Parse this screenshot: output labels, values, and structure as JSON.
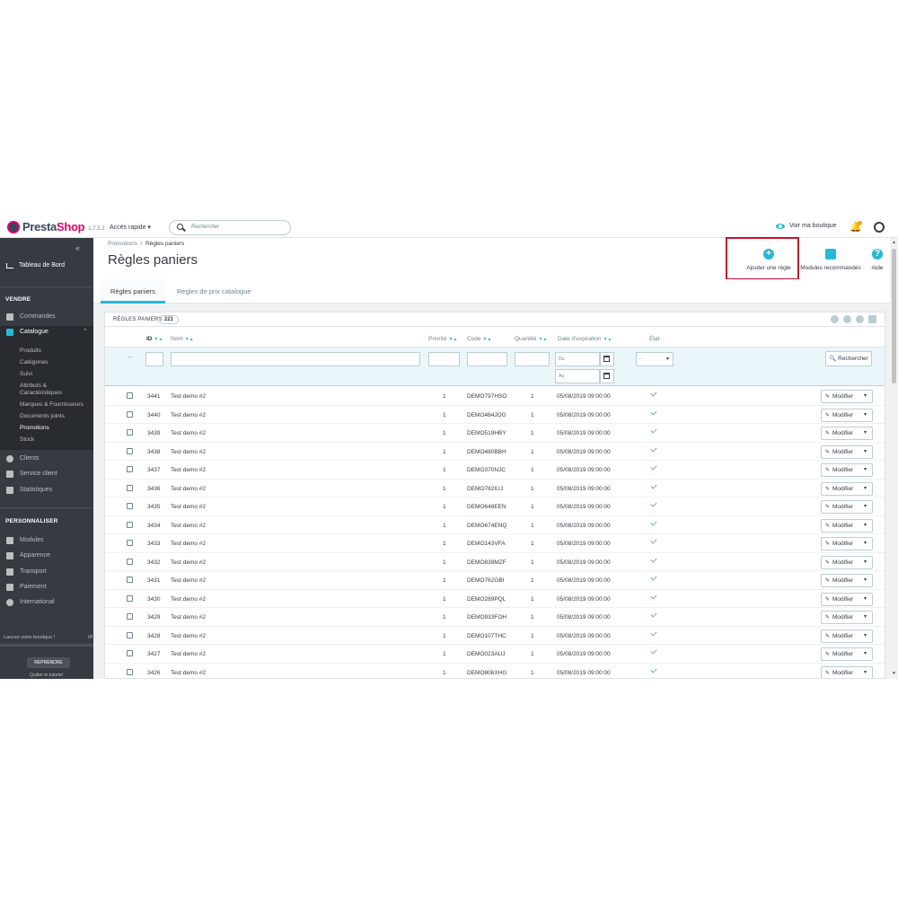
{
  "header": {
    "logo_prefix": "Presta",
    "logo_suffix": "Shop",
    "version": "1.7.5.2",
    "quick_access": "Accès rapide ▾",
    "search_placeholder": "Rechercher",
    "view_shop": "Voir ma boutique"
  },
  "sidebar": {
    "collapse": "«",
    "dashboard": "Tableau de Bord",
    "sell_title": "VENDRE",
    "orders": "Commandes",
    "catalog": "Catalogue",
    "catalog_sub": [
      "Produits",
      "Catégories",
      "Suivi",
      "Attributs &",
      "Caractéristiques",
      "Marques & Fournisseurs",
      "Documents joints",
      "Promotions",
      "Stock"
    ],
    "clients": "Clients",
    "customer_service": "Service client",
    "stats": "Statistiques",
    "customize_title": "PERSONNALISER",
    "modules": "Modules",
    "appearance": "Apparence",
    "transport": "Transport",
    "payment": "Paiement",
    "international": "International",
    "onboarding_text": "Lancez votre boutique !",
    "onboarding_pct": "0%",
    "resume_button": "REPRENDRE",
    "quit_tutorial": "Quitter le tutoriel"
  },
  "breadcrumb": {
    "parent": "Promotions",
    "sep": "/",
    "current": "Règles paniers"
  },
  "page_title": "Règles paniers",
  "toolbar": {
    "add_rule": "Ajouter une règle",
    "recommended_modules": "Modules recommandés",
    "help": "Aide"
  },
  "tabs": [
    "Règles paniers",
    "Règles de prix catalogue"
  ],
  "panel": {
    "title": "RÈGLES PANIERS",
    "count": "221",
    "columns": {
      "id": "ID",
      "name": "Nom",
      "priority": "Priorité",
      "code": "Code",
      "quantity": "Quantité",
      "expiration": "Date d'expiration",
      "status": "État"
    },
    "filter": {
      "dash": "--",
      "from": "Du",
      "to": "Au",
      "select": "-",
      "search_button": "Rechercher"
    },
    "edit_label": "Modifier",
    "rows": [
      {
        "id": "3441",
        "name": "Test demo #2",
        "priority": "1",
        "code": "DEMO797HSO",
        "qty": "1",
        "date": "05/08/2019 09:00:00"
      },
      {
        "id": "3440",
        "name": "Test demo #2",
        "priority": "1",
        "code": "DEMO464JOG",
        "qty": "1",
        "date": "05/08/2019 09:00:00"
      },
      {
        "id": "3439",
        "name": "Test demo #2",
        "priority": "1",
        "code": "DEMO519HBY",
        "qty": "1",
        "date": "05/08/2019 09:00:00"
      },
      {
        "id": "3438",
        "name": "Test demo #2",
        "priority": "1",
        "code": "DEMO480BBH",
        "qty": "1",
        "date": "05/08/2019 09:00:00"
      },
      {
        "id": "3437",
        "name": "Test demo #2",
        "priority": "1",
        "code": "DEMO370NJC",
        "qty": "1",
        "date": "05/08/2019 09:00:00"
      },
      {
        "id": "3436",
        "name": "Test demo #2",
        "priority": "1",
        "code": "DEMO782IUJ",
        "qty": "1",
        "date": "05/08/2019 09:00:00"
      },
      {
        "id": "3435",
        "name": "Test demo #2",
        "priority": "1",
        "code": "DEMO648EEN",
        "qty": "1",
        "date": "05/08/2019 09:00:00"
      },
      {
        "id": "3434",
        "name": "Test demo #2",
        "priority": "1",
        "code": "DEMO674ENQ",
        "qty": "1",
        "date": "05/08/2019 09:00:00"
      },
      {
        "id": "3433",
        "name": "Test demo #2",
        "priority": "1",
        "code": "DEMO143VFA",
        "qty": "1",
        "date": "05/08/2019 09:00:00"
      },
      {
        "id": "3432",
        "name": "Test demo #2",
        "priority": "1",
        "code": "DEMO839MZF",
        "qty": "1",
        "date": "05/08/2019 09:00:00"
      },
      {
        "id": "3431",
        "name": "Test demo #2",
        "priority": "1",
        "code": "DEMO762GBI",
        "qty": "1",
        "date": "05/08/2019 09:00:00"
      },
      {
        "id": "3430",
        "name": "Test demo #2",
        "priority": "1",
        "code": "DEMO289PQL",
        "qty": "1",
        "date": "05/08/2019 09:00:00"
      },
      {
        "id": "3429",
        "name": "Test demo #2",
        "priority": "1",
        "code": "DEMO933FOH",
        "qty": "1",
        "date": "05/08/2019 09:00:00"
      },
      {
        "id": "3428",
        "name": "Test demo #2",
        "priority": "1",
        "code": "DEMO107THC",
        "qty": "1",
        "date": "05/08/2019 09:00:00"
      },
      {
        "id": "3427",
        "name": "Test demo #2",
        "priority": "1",
        "code": "DEMO023AUJ",
        "qty": "1",
        "date": "05/08/2019 09:00:00"
      },
      {
        "id": "3426",
        "name": "Test demo #2",
        "priority": "1",
        "code": "DEMO806XHG",
        "qty": "1",
        "date": "05/08/2019 09:00:00"
      }
    ]
  },
  "colors": {
    "accent": "#25b9d7",
    "sidebar": "#363a41",
    "highlight": "#c8102e",
    "success": "#70b580"
  }
}
